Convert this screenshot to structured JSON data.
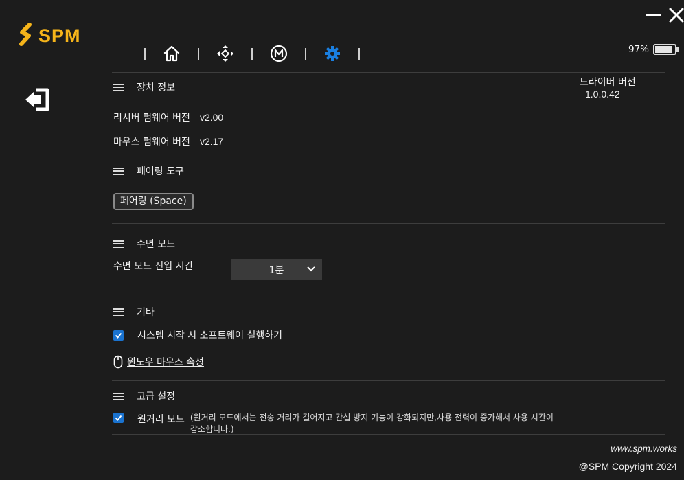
{
  "app": {
    "logo_text": "SPM"
  },
  "window": {
    "minimize_icon": "minimize-icon",
    "close_icon": "close-icon"
  },
  "nav": {
    "items": [
      {
        "icon": "home-icon"
      },
      {
        "icon": "move-arrows-icon"
      },
      {
        "icon": "macro-m-icon"
      },
      {
        "icon": "gear-icon",
        "active": true
      }
    ],
    "active_color": "#1a7fe0"
  },
  "battery": {
    "label": "97%",
    "level": 0.97
  },
  "driver": {
    "label": "드라이버 버전",
    "value": "1.0.0.42"
  },
  "device_info": {
    "title": "장치 정보",
    "receiver_label": "리시버 펌웨어 버전",
    "receiver_value": "v2.00",
    "mouse_label": "마우스 펌웨어 버전",
    "mouse_value": "v2.17"
  },
  "pairing": {
    "title": "페어링 도구",
    "button": "페어링 (Space)"
  },
  "sleep": {
    "title": "수면 모드",
    "entry_label": "수면 모드 진입 시간",
    "selected": "1분"
  },
  "misc": {
    "title": "기타",
    "startup_label": "시스템 시작 시 소프트웨어 실행하기",
    "startup_checked": true,
    "mouse_props_link": "윈도우 마우스 속성"
  },
  "advanced": {
    "title": "고급 설정",
    "long_range_label": "원거리 모드",
    "long_range_checked": true,
    "long_range_note_line1": "(원거리 모드에서는 전송 거리가 길어지고 간섭 방지 기능이 강화되지만,사용 전력이 증가해서 사용 시간이",
    "long_range_note_line2": "감소합니다.)"
  },
  "footer": {
    "url": "www.spm.works",
    "copyright": "@SPM Copyright 2024"
  },
  "colors": {
    "brand": "#f5b41a",
    "accent": "#1a73d0",
    "background": "#1c1c1c"
  }
}
